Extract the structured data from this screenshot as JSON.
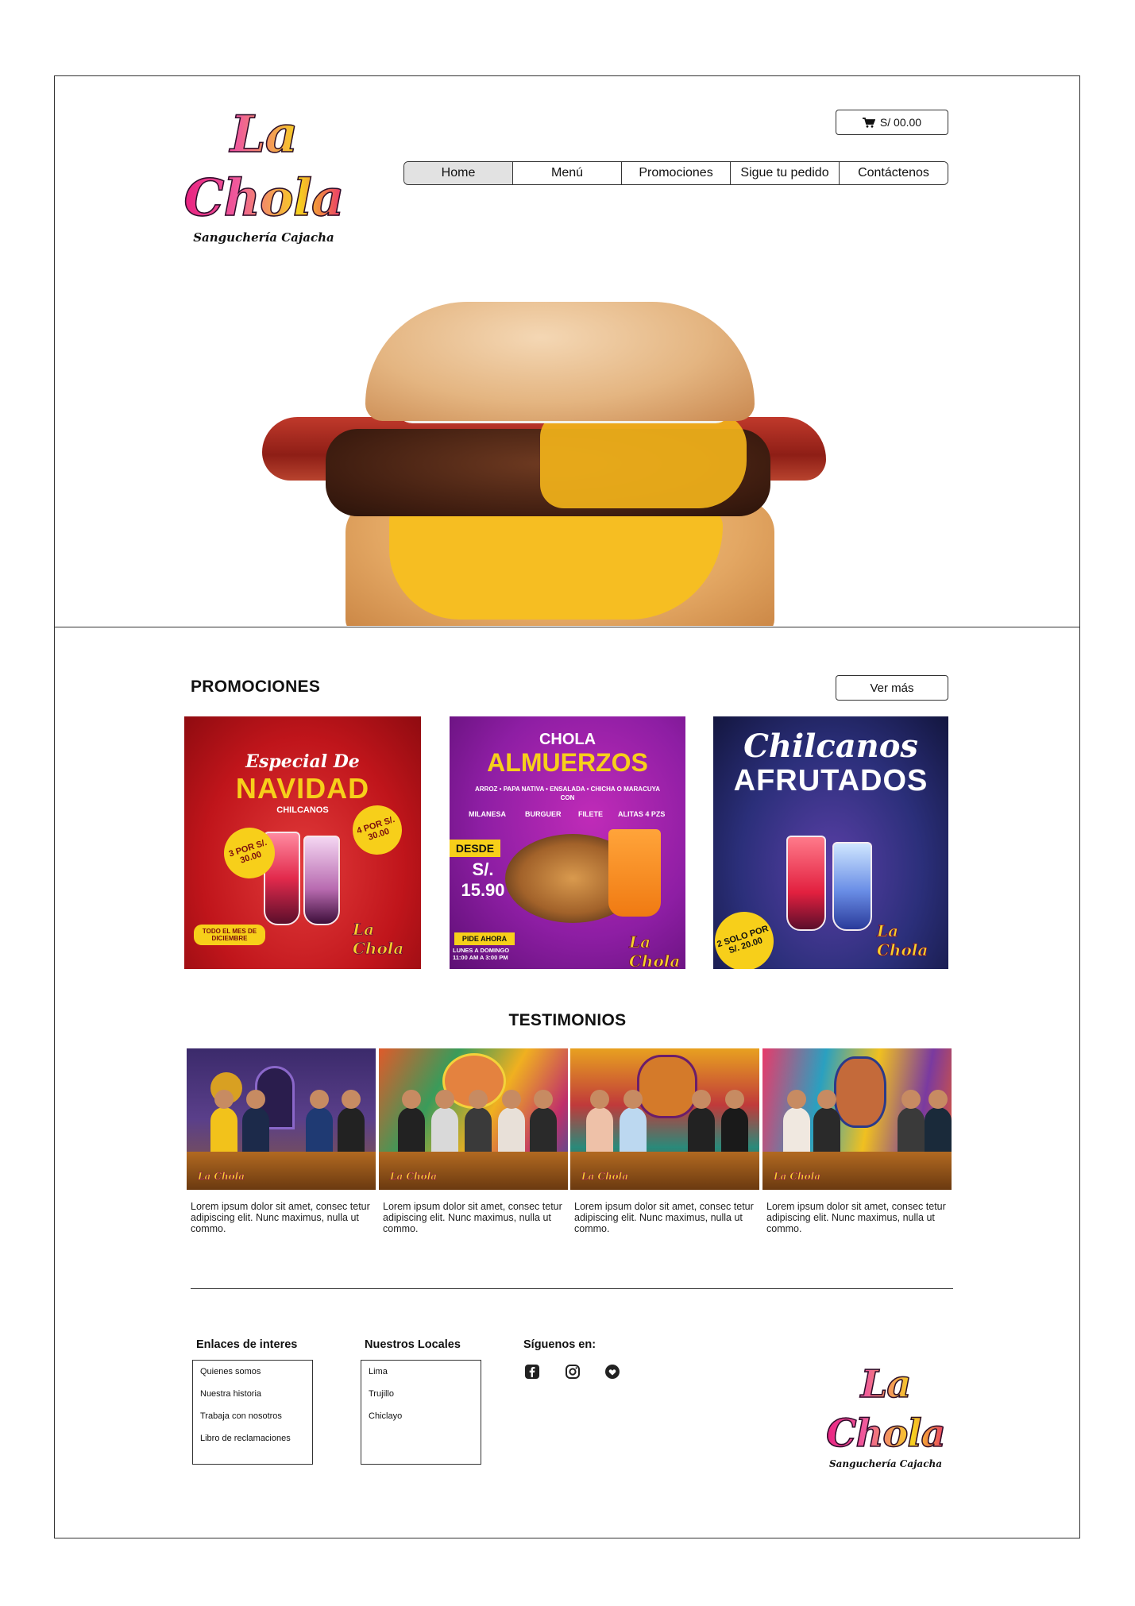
{
  "brand": {
    "name": "La Chola",
    "tagline": "Sanguchería Cajacha"
  },
  "header": {
    "cart_label": "S/ 00.00",
    "nav": [
      {
        "label": "Home",
        "active": true
      },
      {
        "label": "Menú",
        "active": false
      },
      {
        "label": "Promociones",
        "active": false
      },
      {
        "label": "Sigue tu pedido",
        "active": false
      },
      {
        "label": "Contáctenos",
        "active": false
      }
    ]
  },
  "promociones": {
    "title": "PROMOCIONES",
    "ver_mas": "Ver más",
    "cards": [
      {
        "heading_script": "Especial De",
        "heading": "NAVIDAD",
        "sub": "CHILCANOS",
        "badge_1": "3 POR S/. 30.00",
        "badge_2": "4 POR S/. 30.00",
        "note": "TODO EL MES DE DICIEMBRE",
        "colors": {
          "bg": "#c0151b",
          "accent": "#f7cf1a"
        }
      },
      {
        "heading_small": "CHOLA",
        "heading": "ALMUERZOS",
        "includes": "ARROZ • PAPA NATIVA • ENSALADA • CHICHA O MARACUYA CON",
        "options": [
          "MILANESA",
          "BURGUER",
          "FILETE",
          "ALITAS 4 PZS"
        ],
        "desde": "DESDE",
        "price": "S/. 15.90",
        "cta": "PIDE AHORA",
        "hours": "LUNES A DOMINGO 11:00 AM A 3:00 PM",
        "colors": {
          "bg": "#8e1ea4",
          "accent": "#f7cf1a"
        }
      },
      {
        "heading_script": "Chilcanos",
        "heading": "AFRUTADOS",
        "badge": "2 SOLO POR S/. 20.00",
        "colors": {
          "bg": "#2b2f7a",
          "accent": "#f7cf1a"
        }
      }
    ]
  },
  "testimonios": {
    "title": "TESTIMONIOS",
    "items": [
      {
        "caption": "Lorem ipsum dolor sit amet, consec tetur adipiscing elit. Nunc maximus, nulla ut commo."
      },
      {
        "caption": "Lorem ipsum dolor sit amet, consec tetur adipiscing elit. Nunc maximus, nulla ut commo."
      },
      {
        "caption": "Lorem ipsum dolor sit amet, consec tetur adipiscing elit. Nunc maximus, nulla ut commo."
      },
      {
        "caption": "Lorem ipsum dolor sit amet, consec tetur adipiscing elit. Nunc maximus, nulla ut commo."
      }
    ]
  },
  "footer": {
    "enlaces": {
      "title": "Enlaces de interes",
      "items": [
        "Quienes somos",
        "Nuestra historia",
        "Trabaja con nosotros",
        "Libro de reclamaciones"
      ]
    },
    "locales": {
      "title": "Nuestros Locales",
      "items": [
        "Lima",
        "Trujillo",
        "Chiclayo"
      ]
    },
    "siguenos": {
      "title": "Síguenos en:",
      "icons": [
        "facebook-icon",
        "instagram-icon",
        "heart-icon"
      ]
    }
  }
}
